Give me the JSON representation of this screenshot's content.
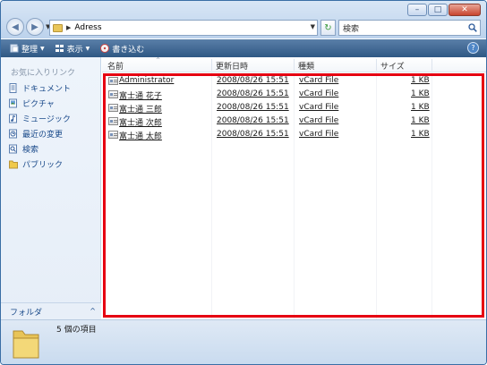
{
  "address": {
    "path": "Adress"
  },
  "search": {
    "placeholder": "検索"
  },
  "toolbar": {
    "organize": "整理",
    "views": "表示",
    "burn": "書き込む"
  },
  "sidebar": {
    "title": "お気に入りリンク",
    "items": [
      {
        "label": "ドキュメント",
        "icon": "documents-icon"
      },
      {
        "label": "ピクチャ",
        "icon": "pictures-icon"
      },
      {
        "label": "ミュージック",
        "icon": "music-icon"
      },
      {
        "label": "最近の変更",
        "icon": "recent-icon"
      },
      {
        "label": "検索",
        "icon": "search-icon"
      },
      {
        "label": "パブリック",
        "icon": "public-folder-icon"
      }
    ],
    "folders_label": "フォルダ"
  },
  "columns": {
    "name": "名前",
    "modified": "更新日時",
    "type": "種類",
    "size": "サイズ"
  },
  "files": [
    {
      "name": "Administrator",
      "modified": "2008/08/26 15:51",
      "type": "vCard File",
      "size": "1 KB"
    },
    {
      "name": "富士通 花子",
      "modified": "2008/08/26 15:51",
      "type": "vCard File",
      "size": "1 KB"
    },
    {
      "name": "富士通 三郎",
      "modified": "2008/08/26 15:51",
      "type": "vCard File",
      "size": "1 KB"
    },
    {
      "name": "富士通 次郎",
      "modified": "2008/08/26 15:51",
      "type": "vCard File",
      "size": "1 KB"
    },
    {
      "name": "富士通 太郎",
      "modified": "2008/08/26 15:51",
      "type": "vCard File",
      "size": "1 KB"
    }
  ],
  "status": {
    "count": "5 個の項目"
  },
  "colors": {
    "highlight": "#e60012",
    "toolbar": "#3d6590",
    "link": "#1a4a8a"
  }
}
